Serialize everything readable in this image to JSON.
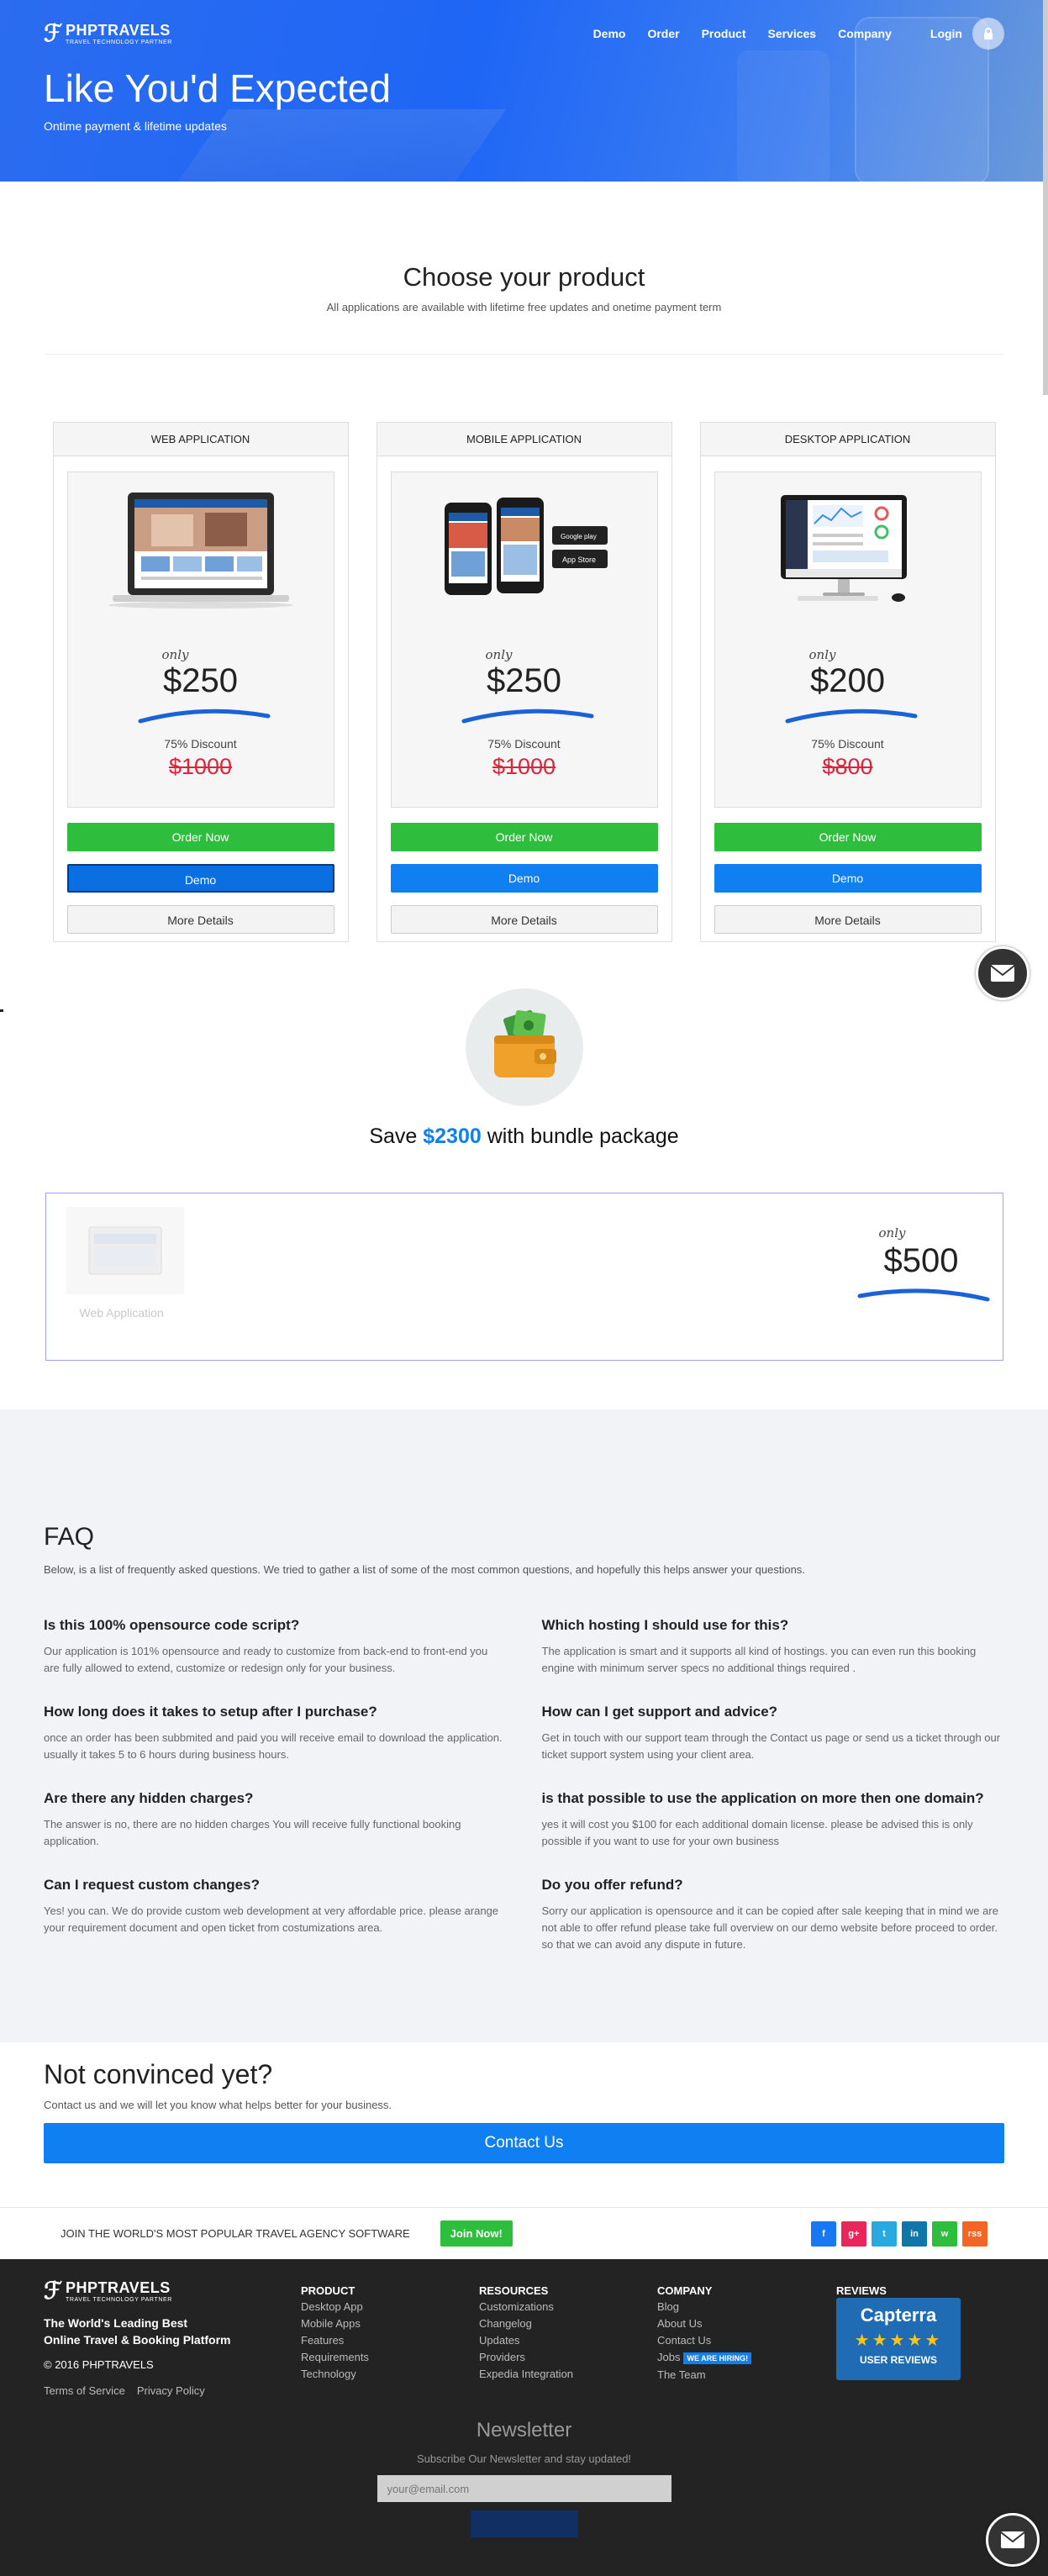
{
  "brand": {
    "name": "PHPTRAVELS",
    "tagline": "TRAVEL TECHNOLOGY PARTNER"
  },
  "nav": {
    "items": [
      "Demo",
      "Order",
      "Product",
      "Services",
      "Company"
    ],
    "login": "Login"
  },
  "hero": {
    "title": "Like You'd Expected",
    "subtitle": "Ontime payment & lifetime updates"
  },
  "choose": {
    "title": "Choose your product",
    "subtitle": "All applications are available with lifetime free updates and onetime payment term"
  },
  "products": [
    {
      "name": "WEB APPLICATION",
      "only": "only",
      "price": "$250",
      "discount": "75% Discount",
      "old_price": "$1000",
      "order": "Order Now",
      "demo": "Demo",
      "more": "More Details"
    },
    {
      "name": "MOBILE APPLICATION",
      "only": "only",
      "price": "$250",
      "discount": "75% Discount",
      "old_price": "$1000",
      "order": "Order Now",
      "demo": "Demo",
      "more": "More Details"
    },
    {
      "name": "DESKTOP APPLICATION",
      "only": "only",
      "price": "$200",
      "discount": "75% Discount",
      "old_price": "$800",
      "order": "Order Now",
      "demo": "Demo",
      "more": "More Details"
    }
  ],
  "mobile_badges": {
    "google": "Google play",
    "apple": "App Store"
  },
  "bundle": {
    "save_prefix": "Save ",
    "save_amount": "$2300",
    "save_suffix": " with bundle package",
    "item_label": "Web Application",
    "only": "only",
    "price": "$500"
  },
  "faq": {
    "title": "FAQ",
    "intro": "Below, is a list of frequently asked questions. We tried to gather a list of some of the most common questions, and hopefully this helps answer your questions.",
    "left": [
      {
        "q": "Is this 100% opensource code script?",
        "a": "Our application is 101% opensource and ready to customize from back-end to front-end you are fully allowed to extend, customize or redesign only for your business."
      },
      {
        "q": "How long does it takes to setup after I purchase?",
        "a": "once an order has been subbmited and paid you will receive email to download the application. usually it takes 5 to 6 hours during business hours."
      },
      {
        "q": "Are there any hidden charges?",
        "a": "The answer is no, there are no hidden charges You will receive fully functional booking application."
      },
      {
        "q": "Can I request custom changes?",
        "a": "Yes! you can. We do provide custom web development at very affordable price. please arange your requirement document and open ticket from costumizations area."
      }
    ],
    "right": [
      {
        "q": "Which hosting I should use for this?",
        "a": "The application is smart and it supports all kind of hostings. you can even run this booking engine with minimum server specs no additional things required ."
      },
      {
        "q": "How can I get support and advice?",
        "a": "Get in touch with our support team through the Contact us page or send us a ticket through our ticket support system using your client area."
      },
      {
        "q": "is that possible to use the application on more then one domain?",
        "a": "yes it will cost you $100 for each additional domain license. please be advised this is only possible if you want to use for your own business"
      },
      {
        "q": "Do you offer refund?",
        "a": "Sorry our application is opensource and it can be copied after sale keeping that in mind we are not able to offer refund please take full overview on our demo website before proceed to order. so that we can avoid any dispute in future."
      }
    ]
  },
  "convinced": {
    "title": "Not convinced yet?",
    "text": "Contact us and we will let you know what helps better for your business.",
    "button": "Contact Us"
  },
  "join": {
    "text": "JOIN THE WORLD'S MOST POPULAR TRAVEL AGENCY SOFTWARE",
    "button": "Join Now!"
  },
  "socials": [
    {
      "label": "f",
      "color": "#1877f2"
    },
    {
      "label": "g+",
      "color": "#e8265c"
    },
    {
      "label": "t",
      "color": "#2aa9e0"
    },
    {
      "label": "in",
      "color": "#0e76a8"
    },
    {
      "label": "w",
      "color": "#2ebd3d"
    },
    {
      "label": "rss",
      "color": "#f26522"
    }
  ],
  "footer": {
    "strapline_1": "The World's Leading Best",
    "strapline_2": "Online Travel & Booking Platform",
    "copyright": "© 2016 PHPTRAVELS",
    "terms": "Terms of Service",
    "privacy": "Privacy Policy",
    "product": {
      "title": "PRODUCT",
      "links": [
        "Desktop App",
        "Mobile Apps",
        "Features",
        "Requirements",
        "Technology"
      ]
    },
    "resources": {
      "title": "RESOURCES",
      "links": [
        "Customizations",
        "Changelog",
        "Updates",
        "Providers",
        "Expedia Integration"
      ]
    },
    "company": {
      "title": "COMPANY",
      "links": [
        "Blog",
        "About Us",
        "Contact Us",
        "Jobs",
        "The Team"
      ],
      "hiring": "WE ARE HIRING!"
    },
    "reviews": {
      "title": "REVIEWS",
      "capterra": "Capterra",
      "stars": "★★★★★",
      "user_reviews": "USER REVIEWS"
    }
  },
  "newsletter": {
    "title": "Newsletter",
    "text": "Subscribe Our Newsletter and stay updated!",
    "placeholder": "your@email.com"
  },
  "colors": {
    "brand_blue": "#0f7ff2",
    "green": "#2ebd3d",
    "old_price_red": "#e0233d",
    "footer_bg": "#232323"
  }
}
